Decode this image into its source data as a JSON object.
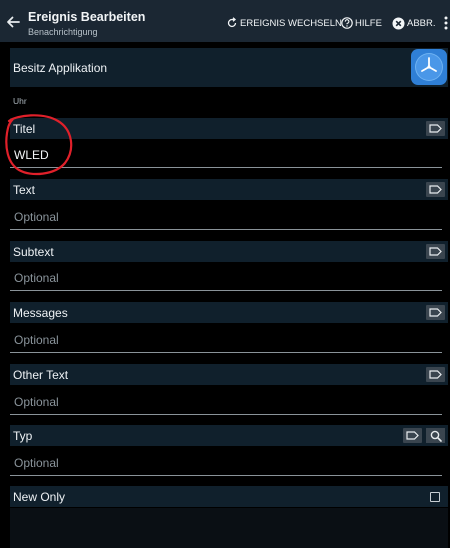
{
  "appbar": {
    "title": "Ereignis Bearbeiten",
    "subtitle": "Benachrichtigung",
    "actions": {
      "switch_event": "EREIGNIS WECHSELN",
      "help": "HILFE",
      "cancel": "ABBR."
    }
  },
  "app_row": {
    "label": "Besitz Applikation",
    "icon": "clock-icon"
  },
  "section_label": "Uhr",
  "fields": {
    "titel": {
      "label": "Titel",
      "value": "WLED",
      "placeholder": ""
    },
    "text": {
      "label": "Text",
      "value": "",
      "placeholder": "Optional"
    },
    "subtext": {
      "label": "Subtext",
      "value": "",
      "placeholder": "Optional"
    },
    "messages": {
      "label": "Messages",
      "value": "",
      "placeholder": "Optional"
    },
    "other_text": {
      "label": "Other Text",
      "value": "",
      "placeholder": "Optional"
    },
    "typ": {
      "label": "Typ",
      "value": "",
      "placeholder": "Optional"
    }
  },
  "new_only": {
    "label": "New Only",
    "checked": false
  },
  "colors": {
    "appbar_bg": "#1b2733",
    "row_bg": "#10202c",
    "button_bg": "#3a454f",
    "annotation_red": "#e0202a",
    "clock_blue": "#3d8be0"
  }
}
